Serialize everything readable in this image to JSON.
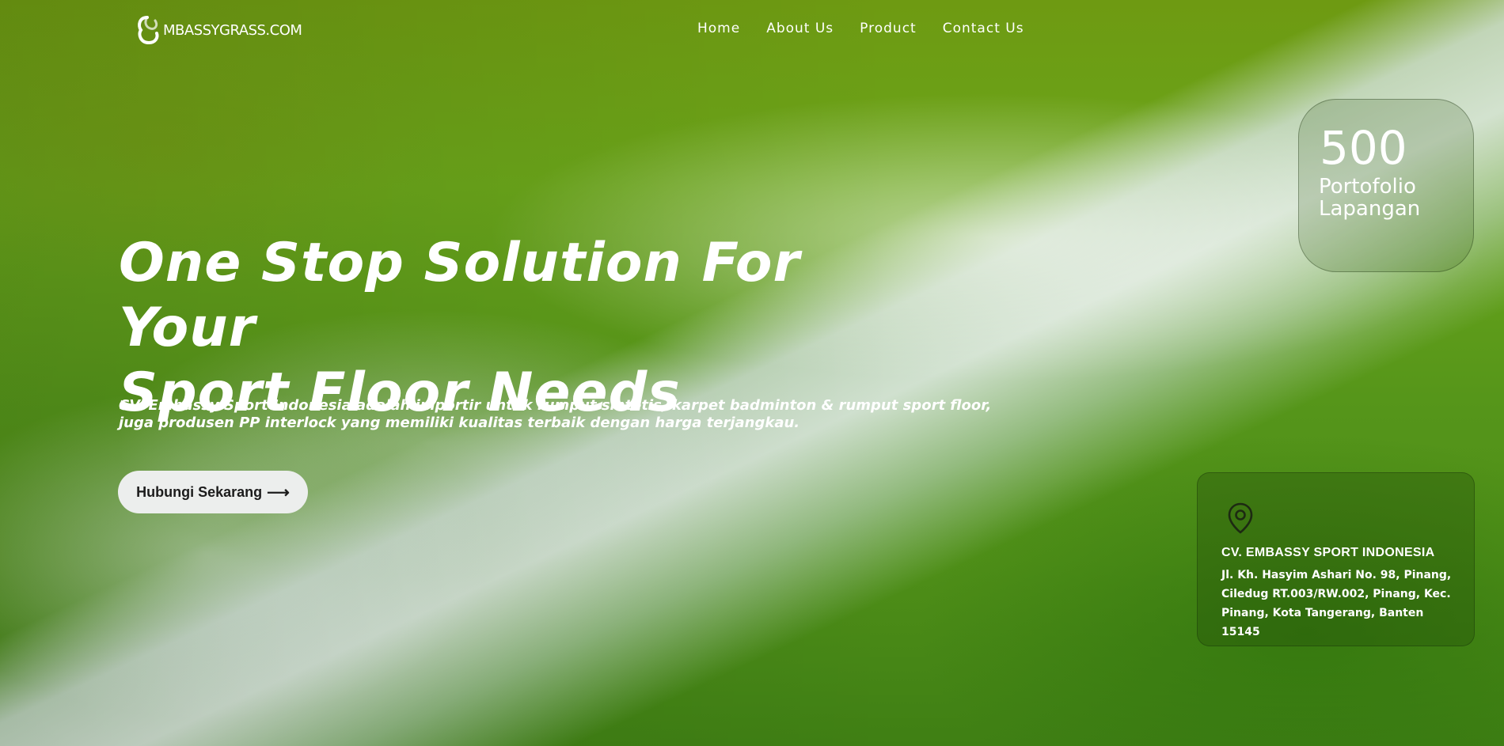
{
  "header": {
    "logo_text": "MBASSYGRASS.COM",
    "nav": [
      {
        "label": "Home"
      },
      {
        "label": "About Us"
      },
      {
        "label": "Product"
      },
      {
        "label": "Contact Us"
      }
    ]
  },
  "hero": {
    "title_line1": "One Stop Solution For Your",
    "title_line2": "Sport Floor Needs",
    "description": "CV. Embassy Sport Indonesia adalah importir untuk rumput sintetis, karpet badminton & rumput sport floor, juga produsen PP interlock yang memiliki kualitas terbaik dengan harga terjangkau.",
    "cta_label": "Hubungi Sekarang",
    "cta_arrow": "⟶"
  },
  "stat": {
    "number": "500",
    "label_line1": "Portofolio",
    "label_line2": "Lapangan"
  },
  "address": {
    "icon": "location-pin-icon",
    "company": "CV. EMBASSY SPORT INDONESIA",
    "line1": "Jl. Kh. Hasyim Ashari No. 98, Pinang,",
    "line2": "Ciledug RT.003/RW.002, Pinang, Kec.",
    "line3": "Pinang, Kota Tangerang, Banten 15145"
  },
  "colors": {
    "text": "#ffffff",
    "button_bg": "#eceeed",
    "button_text": "#1c1c1c"
  }
}
